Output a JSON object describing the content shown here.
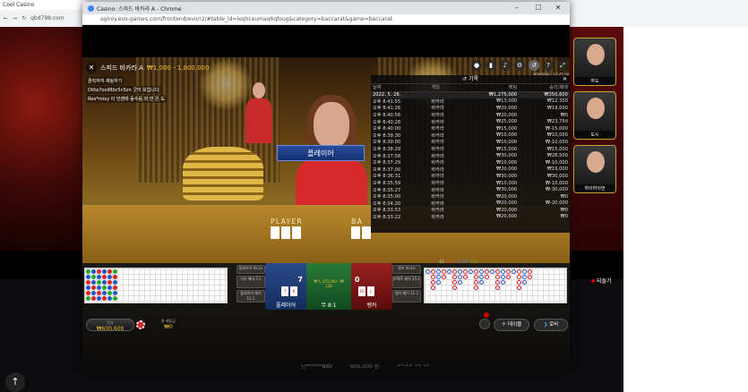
{
  "bg_browser": {
    "tab_title": "Cool Casino",
    "url": "qbd798.com",
    "back_button_text": "되돌기",
    "behind_row": [
      "단******889",
      "600,000 원",
      "06:28 19:03"
    ]
  },
  "popup": {
    "window_title": "Casino: 스피드 바카라 A - Chrome",
    "url": "agiroy.evo-games.com/frontend/evo/r2/#table_id=leqhceumaq6qfoug&category=baccarat&game=baccarat",
    "controls": [
      "–",
      "☐",
      "✕"
    ]
  },
  "game": {
    "title": "스피드 바카라 A",
    "stake": "₩1,000 - 1,000,000",
    "chat": [
      "클릭하여 채팅하기",
      "Ditta7ooil8bc5n5zn 굿어 보입니다",
      "Ree*mixy 이 언랜태 동수음 와 번 뜬 도"
    ],
    "timestamp": "#000088 · 10:45:09",
    "player_banner": "플레이어",
    "felt_player": "PLAYER",
    "felt_banker": "BA"
  },
  "history": {
    "title": "기록",
    "headers": [
      "날짜",
      "게임",
      "배팅",
      "승리/패배"
    ],
    "date_row": {
      "date": "2022. 5. 28.",
      "bet": "₩1,275,000",
      "result": "₩350,600"
    },
    "rows": [
      [
        "오후 8:41:55",
        "바카라",
        "₩13,000",
        "₩12,350"
      ],
      [
        "오후 8:41:26",
        "바카라",
        "₩20,000",
        "₩19,000"
      ],
      [
        "오후 8:40:56",
        "바카라",
        "₩20,000",
        "₩0"
      ],
      [
        "오후 8:40:28",
        "바카라",
        "₩25,000",
        "₩23,750"
      ],
      [
        "오후 8:40:00",
        "바카라",
        "₩15,000",
        "₩-15,000"
      ],
      [
        "오후 8:39:30",
        "바카라",
        "₩10,000",
        "₩10,000"
      ],
      [
        "오후 8:39:00",
        "바카라",
        "₩10,000",
        "₩-10,000"
      ],
      [
        "오후 8:38:29",
        "바카라",
        "₩15,000",
        "₩15,000"
      ],
      [
        "오후 8:37:58",
        "바카라",
        "₩30,000",
        "₩28,500"
      ],
      [
        "오후 8:37:29",
        "바카라",
        "₩10,000",
        "₩-10,000"
      ],
      [
        "오후 8:37:00",
        "바카라",
        "₩20,000",
        "₩19,000"
      ],
      [
        "오후 8:36:31",
        "바카라",
        "₩30,000",
        "₩30,000"
      ],
      [
        "오후 8:35:59",
        "바카라",
        "₩10,000",
        "₩-10,000"
      ],
      [
        "오후 8:35:27",
        "바카라",
        "₩30,000",
        "₩-30,000"
      ],
      [
        "오후 8:35:00",
        "바카라",
        "₩20,000",
        "₩0"
      ],
      [
        "오후 8:34:20",
        "바카라",
        "₩20,000",
        "₩-20,000"
      ],
      [
        "오후 8:33:53",
        "바카라",
        "₩20,000",
        "₩0"
      ],
      [
        "오후 8:33:22",
        "바카라",
        "₩20,000",
        "₩0"
      ]
    ]
  },
  "betting": {
    "player_label": "플레이어",
    "tie_label": "무 8:1",
    "banker_label": "뱅커",
    "player_score": "7",
    "banker_score": "0",
    "player_pair": "플레이어 페어 11:1",
    "banker_pair": "뱅커 페어 11:1",
    "player_bonus": "플레이어 보너스",
    "banker_bonus": "뱅커 보너스",
    "either_pair": "이더 페어 5:1",
    "perfect_pair": "퍼펙트 페어 25:1",
    "tie_amounts": "₩ 1,375,000 · ₩ 128",
    "player_cards": [
      "7",
      "K"
    ],
    "banker_cards": [
      "10",
      "J"
    ]
  },
  "stats": {
    "total": "41",
    "banker": "B 18",
    "player": "P 19",
    "tie": "T 4"
  },
  "footer": {
    "balance_label": "잔고",
    "balance": "₩600,600",
    "total_bet_label": "총 배팅금",
    "total_bet": "₩0",
    "tables_label": "테이블",
    "lobby_label": "로비"
  },
  "dealers": [
    "하도",
    "도시",
    "하이하이먼"
  ],
  "colors": {
    "accent_gold": "#f2c230",
    "player_blue": "#143072",
    "banker_red": "#5a0c0c",
    "tie_green": "#0f4a1e"
  }
}
